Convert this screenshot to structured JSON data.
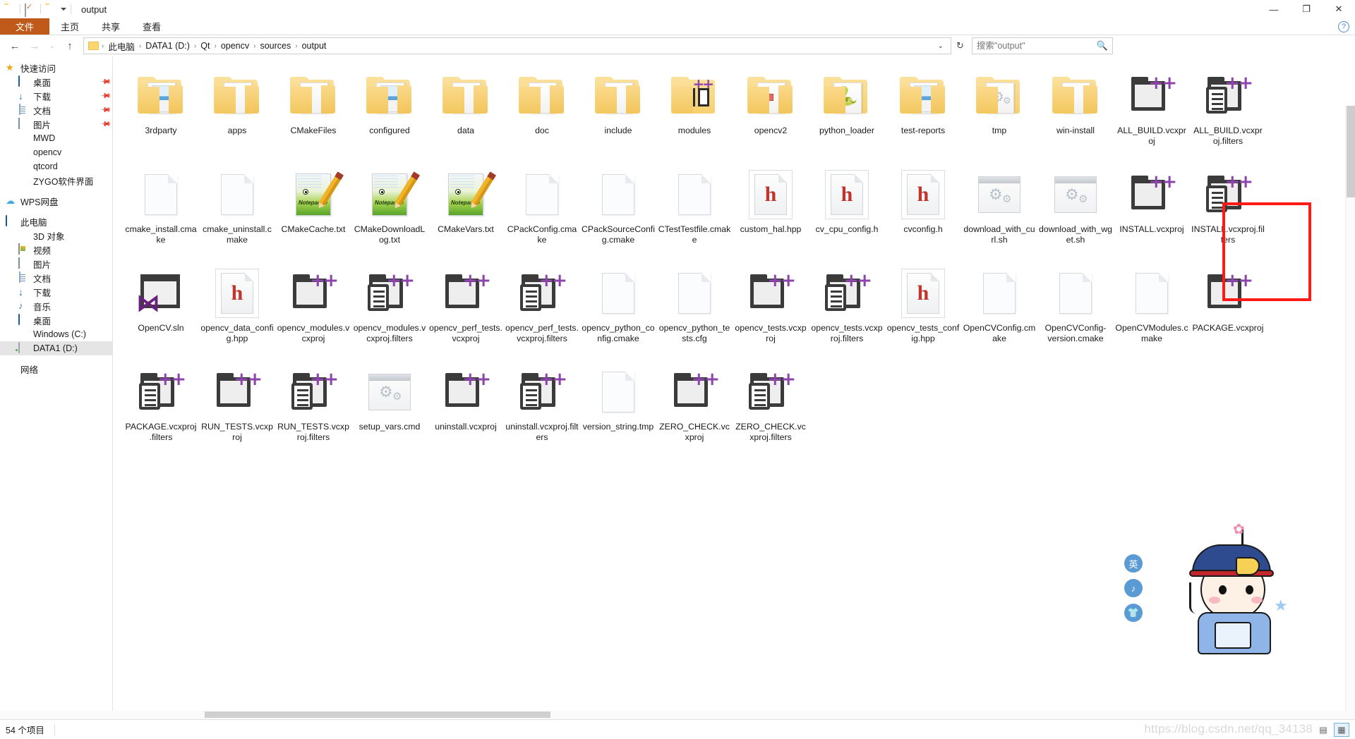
{
  "window": {
    "title": "output",
    "minimize": "—",
    "maximize": "❐",
    "close": "✕"
  },
  "ribbon": {
    "tabs": [
      {
        "label": "文件",
        "active": true
      },
      {
        "label": "主页",
        "active": false
      },
      {
        "label": "共享",
        "active": false
      },
      {
        "label": "查看",
        "active": false
      }
    ],
    "help": "?"
  },
  "address": {
    "back": "←",
    "forward": "→",
    "history": "⌄",
    "up": "↑",
    "crumbs": [
      "此电脑",
      "DATA1 (D:)",
      "Qt",
      "opencv",
      "sources",
      "output"
    ],
    "separator": "›",
    "dropdown": "⌄",
    "refresh": "↻"
  },
  "search": {
    "placeholder": "搜索\"output\"",
    "icon": "search-icon"
  },
  "sidebar": {
    "groups": [
      {
        "header": {
          "label": "快速访问",
          "icon": "star-icon"
        },
        "items": [
          {
            "label": "桌面",
            "icon": "monitor-icon",
            "pinned": true
          },
          {
            "label": "下载",
            "icon": "download-icon",
            "pinned": true
          },
          {
            "label": "文档",
            "icon": "document-icon",
            "pinned": true
          },
          {
            "label": "图片",
            "icon": "picture-icon",
            "pinned": true
          },
          {
            "label": "MWD",
            "icon": "folder-icon",
            "pinned": false
          },
          {
            "label": "opencv",
            "icon": "folder-icon",
            "pinned": false
          },
          {
            "label": "qtcord",
            "icon": "folder-icon",
            "pinned": false
          },
          {
            "label": "ZYGO软件界面",
            "icon": "folder-icon",
            "pinned": false
          }
        ]
      },
      {
        "header": {
          "label": "WPS网盘",
          "icon": "cloud-icon"
        },
        "items": []
      },
      {
        "header": {
          "label": "此电脑",
          "icon": "pc-icon"
        },
        "items": [
          {
            "label": "3D 对象",
            "icon": "3d-object-icon",
            "pinned": false
          },
          {
            "label": "视频",
            "icon": "video-icon",
            "pinned": false
          },
          {
            "label": "图片",
            "icon": "picture-icon",
            "pinned": false
          },
          {
            "label": "文档",
            "icon": "document-icon",
            "pinned": false
          },
          {
            "label": "下载",
            "icon": "download-icon",
            "pinned": false
          },
          {
            "label": "音乐",
            "icon": "music-icon",
            "pinned": false
          },
          {
            "label": "桌面",
            "icon": "monitor-icon",
            "pinned": false
          },
          {
            "label": "Windows (C:)",
            "icon": "windows-drive-icon",
            "pinned": false
          },
          {
            "label": "DATA1 (D:)",
            "icon": "drive-icon",
            "pinned": false,
            "selected": true
          }
        ]
      },
      {
        "header": {
          "label": "网络",
          "icon": "network-icon"
        },
        "items": []
      }
    ]
  },
  "files": [
    {
      "name": "3rdparty",
      "icon": "folder-media-icon"
    },
    {
      "name": "apps",
      "icon": "folder-icon"
    },
    {
      "name": "CMakeFiles",
      "icon": "folder-icon"
    },
    {
      "name": "configured",
      "icon": "folder-media-icon"
    },
    {
      "name": "data",
      "icon": "folder-icon"
    },
    {
      "name": "doc",
      "icon": "folder-icon"
    },
    {
      "name": "include",
      "icon": "folder-icon"
    },
    {
      "name": "modules",
      "icon": "folder-cpp-icon"
    },
    {
      "name": "opencv2",
      "icon": "folder-doc-icon"
    },
    {
      "name": "python_loader",
      "icon": "folder-python-icon"
    },
    {
      "name": "test-reports",
      "icon": "folder-media-icon"
    },
    {
      "name": "tmp",
      "icon": "folder-gear-icon"
    },
    {
      "name": "win-install",
      "icon": "folder-icon"
    },
    {
      "name": "ALL_BUILD.vcxproj",
      "icon": "vcxproj-icon"
    },
    {
      "name": "ALL_BUILD.vcxproj.filters",
      "icon": "vcxproj-filters-icon"
    },
    {
      "name": "cmake_install.cmake",
      "icon": "blank-document-icon"
    },
    {
      "name": "cmake_uninstall.cmake",
      "icon": "blank-document-icon"
    },
    {
      "name": "CMakeCache.txt",
      "icon": "notepadpp-icon"
    },
    {
      "name": "CMakeDownloadLog.txt",
      "icon": "notepadpp-icon"
    },
    {
      "name": "CMakeVars.txt",
      "icon": "notepadpp-icon"
    },
    {
      "name": "CPackConfig.cmake",
      "icon": "blank-document-icon"
    },
    {
      "name": "CPackSourceConfig.cmake",
      "icon": "blank-document-icon"
    },
    {
      "name": "CTestTestfile.cmake",
      "icon": "blank-document-icon"
    },
    {
      "name": "custom_hal.hpp",
      "icon": "header-file-icon"
    },
    {
      "name": "cv_cpu_config.h",
      "icon": "header-file-icon"
    },
    {
      "name": "cvconfig.h",
      "icon": "header-file-icon"
    },
    {
      "name": "download_with_curl.sh",
      "icon": "shell-script-icon"
    },
    {
      "name": "download_with_wget.sh",
      "icon": "shell-script-icon"
    },
    {
      "name": "INSTALL.vcxproj",
      "icon": "vcxproj-icon"
    },
    {
      "name": "INSTALL.vcxproj.filters",
      "icon": "vcxproj-filters-icon"
    },
    {
      "name": "OpenCV.sln",
      "icon": "visual-studio-sln-icon",
      "highlighted": true
    },
    {
      "name": "opencv_data_config.hpp",
      "icon": "header-file-icon"
    },
    {
      "name": "opencv_modules.vcxproj",
      "icon": "vcxproj-icon"
    },
    {
      "name": "opencv_modules.vcxproj.filters",
      "icon": "vcxproj-filters-icon"
    },
    {
      "name": "opencv_perf_tests.vcxproj",
      "icon": "vcxproj-icon"
    },
    {
      "name": "opencv_perf_tests.vcxproj.filters",
      "icon": "vcxproj-filters-icon"
    },
    {
      "name": "opencv_python_config.cmake",
      "icon": "blank-document-icon"
    },
    {
      "name": "opencv_python_tests.cfg",
      "icon": "blank-document-icon"
    },
    {
      "name": "opencv_tests.vcxproj",
      "icon": "vcxproj-icon"
    },
    {
      "name": "opencv_tests.vcxproj.filters",
      "icon": "vcxproj-filters-icon"
    },
    {
      "name": "opencv_tests_config.hpp",
      "icon": "header-file-icon"
    },
    {
      "name": "OpenCVConfig.cmake",
      "icon": "blank-document-icon"
    },
    {
      "name": "OpenCVConfig-version.cmake",
      "icon": "blank-document-icon"
    },
    {
      "name": "OpenCVModules.cmake",
      "icon": "blank-document-icon"
    },
    {
      "name": "PACKAGE.vcxproj",
      "icon": "vcxproj-icon"
    },
    {
      "name": "PACKAGE.vcxproj.filters",
      "icon": "vcxproj-filters-icon"
    },
    {
      "name": "RUN_TESTS.vcxproj",
      "icon": "vcxproj-icon"
    },
    {
      "name": "RUN_TESTS.vcxproj.filters",
      "icon": "vcxproj-filters-icon"
    },
    {
      "name": "setup_vars.cmd",
      "icon": "shell-script-icon"
    },
    {
      "name": "uninstall.vcxproj",
      "icon": "vcxproj-icon"
    },
    {
      "name": "uninstall.vcxproj.filters",
      "icon": "vcxproj-filters-icon"
    },
    {
      "name": "version_string.tmp",
      "icon": "blank-document-icon"
    },
    {
      "name": "ZERO_CHECK.vcxproj",
      "icon": "vcxproj-icon"
    },
    {
      "name": "ZERO_CHECK.vcxproj.filters",
      "icon": "vcxproj-filters-icon"
    }
  ],
  "status": {
    "item_count": "54 个项目",
    "view_details": "▤",
    "view_icons": "▦"
  },
  "watermark": "https://blog.csdn.net/qq_34138",
  "mascot": {
    "badges": [
      "英",
      "♪",
      "👕"
    ],
    "flower": "✿",
    "wand": "★"
  },
  "colors": {
    "file_tab": "#bf5a1a",
    "annotation": "#ff1a1a",
    "folder": "#fcd770",
    "cpp_purple": "#8e44ad",
    "vs_purple": "#68217a",
    "header_red": "#c0342b",
    "selection": "#e5e5e5"
  }
}
